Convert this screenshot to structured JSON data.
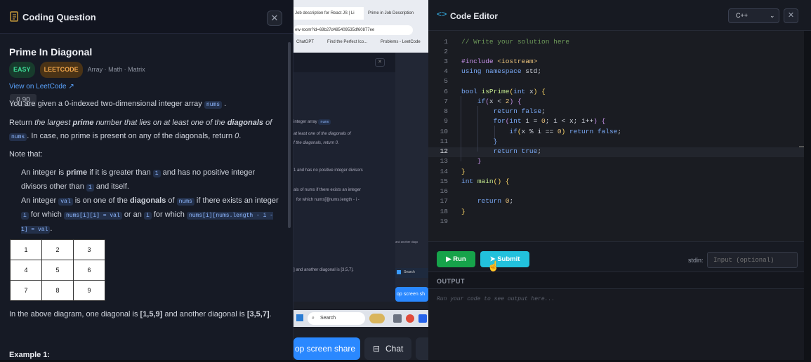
{
  "left": {
    "header_title": "Coding Question",
    "close_label": "✕",
    "problem_title": "Prime In Diagonal",
    "badges": [
      "EASY",
      "LEETCODE"
    ],
    "tags": "Array · Math · Matrix",
    "view_link": "View on LeetCode ↗",
    "tooltip": "0.90",
    "p1_prefix": "You are given a 0-indexed two-dimensional integer array",
    "p1_code": "nums",
    "p1_suffix": ".",
    "p2_a": "Return",
    "p2_b": "the largest",
    "p2_c": "prime",
    "p2_d": "number that lies on at least one of the",
    "p2_e": "diagonals",
    "p2_f": "of",
    "p2_code": "nums",
    "p2_g": ". In case, no prime is present on any of the diagonals, return",
    "p2_h": "0",
    "p2_i": ".",
    "note": "Note that:",
    "b1_a": "An integer is",
    "b1_b": "prime",
    "b1_c": "if it is greater than",
    "b1_code1": "1",
    "b1_d": "and has no positive integer divisors other than",
    "b1_code2": "1",
    "b1_e": "and itself.",
    "b2_a": "An integer",
    "b2_code1": "val",
    "b2_b": "is on one of the",
    "b2_c": "diagonals",
    "b2_d": "of",
    "b2_code2": "nums",
    "b2_e": "if there exists an integer",
    "b2_code3": "i",
    "b2_f": "for which",
    "b2_code4": "nums[i][i] = val",
    "b2_g": "or an",
    "b2_code5": "i",
    "b2_h": "for which",
    "b2_code6": "nums[i][nums.length - i - 1] = val",
    "b2_i": ".",
    "grid": [
      [
        "1",
        "2",
        "3"
      ],
      [
        "4",
        "5",
        "6"
      ],
      [
        "7",
        "8",
        "9"
      ]
    ],
    "diagram_text_a": "In the above diagram, one diagonal is",
    "diagram_text_b": "[1,5,9]",
    "diagram_text_c": "and another diagonal is",
    "diagram_text_d": "[3,5,7]",
    "diagram_text_e": ".",
    "example": "Example 1:"
  },
  "mid": {
    "tab1": "Job description for React JS | Li",
    "tab2": "Prime in Job Description",
    "url": "ew-room?id=69b27d485409535df60877ee",
    "bm1": "ChatGPT",
    "bm2": "Find the Perfect Ico...",
    "bm3": "Problems - LeetCode",
    "search": "Search",
    "share_btn": "op screen share",
    "chat_btn": "Chat",
    "small_share": "op screen sh",
    "t1": "integer array",
    "t1c": "nums",
    "t2": "at least one of the diagonals of",
    "t3": "f the diagonals, return 0.",
    "t4": "1 and has no positive integer divisors",
    "t5": "als of nums if there exists an integer",
    "t6": "for which nums[i][nums.length - i -",
    "t7": "] and another diagonal is [3,5,7].",
    "t8": "and another diago"
  },
  "right": {
    "header_title": "Code Editor",
    "language": "C++",
    "close_label": "✕",
    "run_label": "Run",
    "submit_label": "Submit",
    "stdin_label": "stdin:",
    "stdin_placeholder": "Input (optional)",
    "output_label": "OUTPUT",
    "output_placeholder": "Run your code to see output here...",
    "line_numbers": [
      "1",
      "2",
      "3",
      "4",
      "5",
      "6",
      "7",
      "8",
      "9",
      "10",
      "11",
      "12",
      "13",
      "14",
      "15",
      "16",
      "17",
      "18",
      "19"
    ]
  },
  "colors": {
    "accent_green": "#16a34a",
    "accent_cyan": "#22c1dc",
    "easy": "#1f8a5b",
    "leetcode": "#c9832b"
  }
}
